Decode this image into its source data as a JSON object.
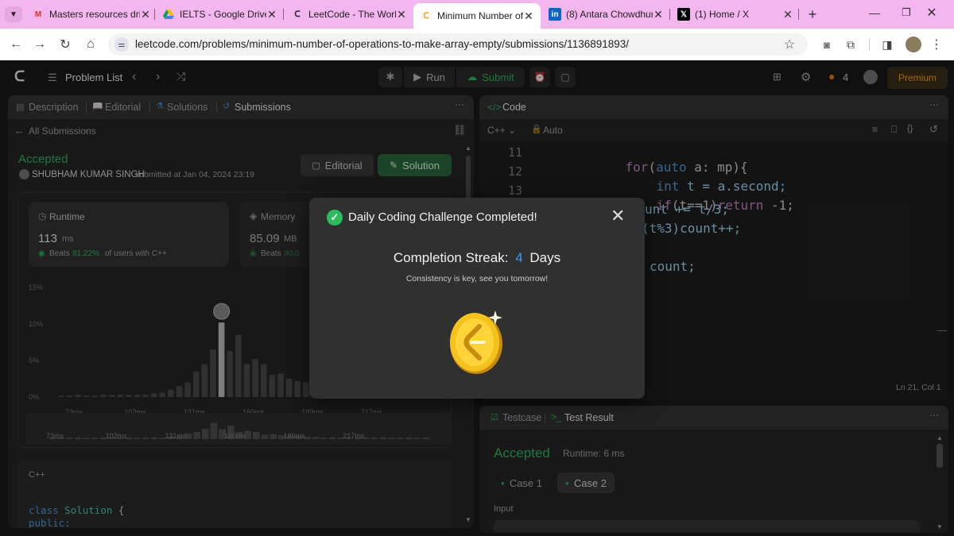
{
  "browser": {
    "tabs": [
      {
        "title": "Masters resources dri",
        "favicon": "gmail-icon"
      },
      {
        "title": "IELTS - Google Drive",
        "favicon": "google-drive-icon"
      },
      {
        "title": "LeetCode - The World",
        "favicon": "leetcode-icon"
      },
      {
        "title": "Minimum Number of",
        "favicon": "leetcode-icon"
      },
      {
        "title": "(8) Antara Chowdhur",
        "favicon": "linkedin-icon"
      },
      {
        "title": "(1) Home / X",
        "favicon": "x-icon"
      }
    ],
    "active_tab": 3,
    "url": "leetcode.com/problems/minimum-number-of-operations-to-make-array-empty/submissions/1136891893/"
  },
  "nav": {
    "problem_list": "Problem List",
    "run": "Run",
    "submit": "Submit",
    "streak_count": "4",
    "premium": "Premium"
  },
  "left_panel": {
    "tabs": [
      "Description",
      "Editorial",
      "Solutions",
      "Submissions"
    ],
    "all_submissions": "All Submissions",
    "status": "Accepted",
    "user": "SHUBHAM KUMAR SINGH",
    "submitted_at": "submitted at Jan 04, 2024 23:19",
    "editorial_btn": "Editorial",
    "solution_btn": "Solution",
    "runtime": {
      "label": "Runtime",
      "value": "113",
      "unit": "ms",
      "beats_prefix": "Beats",
      "beats_pct": "81.22%",
      "beats_suffix": "of users with C++"
    },
    "memory": {
      "label": "Memory",
      "value": "85.09",
      "unit": "MB",
      "beats_prefix": "Beats",
      "beats_pct": "90.0"
    },
    "lang_label": "C++",
    "code_line1_kw": "class",
    "code_line1_name": "Solution",
    "code_line1_brace": "{",
    "code_line2": "public:"
  },
  "chart_data": {
    "type": "bar",
    "y_ticks": [
      "15%",
      "10%",
      "5%",
      "0%"
    ],
    "ylim": [
      0,
      15
    ],
    "x_ticks": [
      "73ms",
      "102ms",
      "131ms",
      "160ms",
      "189ms",
      "217ms"
    ],
    "values": [
      0.2,
      0.2,
      0.3,
      0.2,
      0.2,
      0.3,
      0.3,
      0.3,
      0.3,
      0.3,
      0.3,
      0.5,
      0.6,
      1.0,
      1.5,
      2.0,
      3.5,
      4.5,
      6.5,
      10.2,
      6.3,
      8.5,
      4.5,
      5.2,
      4.5,
      3.0,
      3.2,
      2.5,
      2.2,
      2.0,
      1.6,
      1.5,
      0.9,
      0.7,
      0.5,
      0.4,
      0.3,
      0.3,
      0.3,
      0.3,
      0.2,
      0.2,
      0.2,
      0.2,
      0.2
    ],
    "highlight_index": 19
  },
  "code_panel": {
    "title": "Code",
    "language": "C++",
    "mode": "Auto",
    "lines": [
      {
        "n": "11",
        "text": "for(auto a: mp){"
      },
      {
        "n": "12",
        "text": "int t = a.second;"
      },
      {
        "n": "13",
        "text": "if(t==1)return -1;"
      },
      {
        "n": "",
        "text": "unt += t/3;"
      },
      {
        "n": "",
        "text": "(t%3)count++;"
      },
      {
        "n": "",
        "text": "count;"
      }
    ],
    "cursor_pos": "Ln 21, Col 1"
  },
  "test_panel": {
    "testcase_tab": "Testcase",
    "result_tab": "Test Result",
    "status": "Accepted",
    "runtime": "Runtime: 6 ms",
    "cases": [
      "Case 1",
      "Case 2"
    ],
    "input_label": "Input"
  },
  "modal": {
    "title": "Daily Coding Challenge Completed!",
    "streak_label": "Completion Streak:",
    "streak_value": "4",
    "streak_unit": "Days",
    "message": "Consistency is key, see you tomorrow!"
  }
}
